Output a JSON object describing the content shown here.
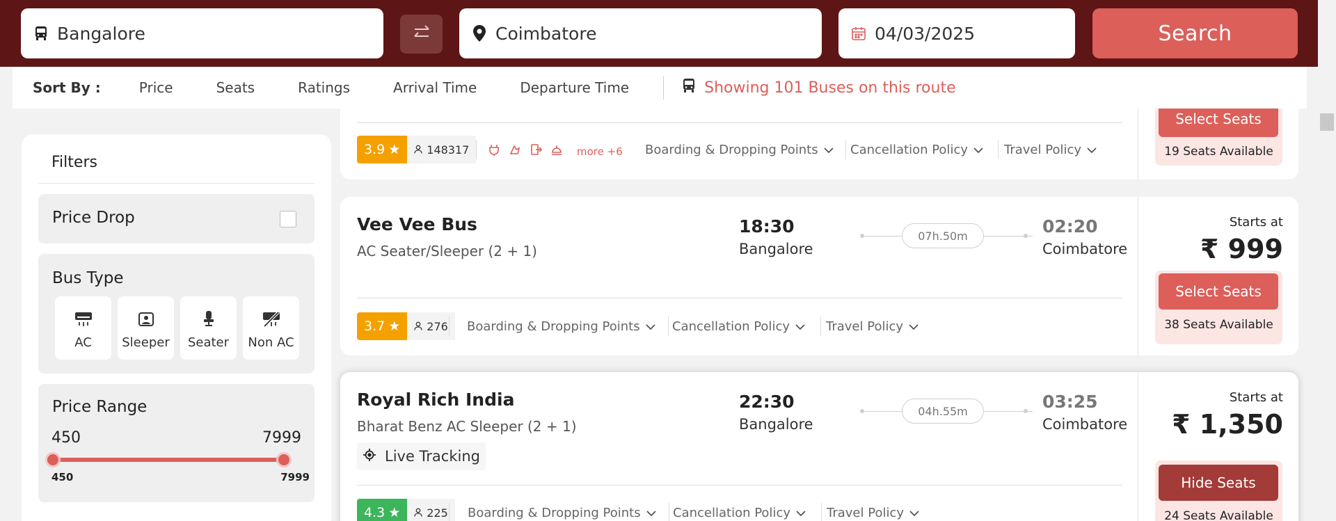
{
  "search": {
    "from": "Bangalore",
    "to": "Coimbatore",
    "date": "04/03/2025",
    "search_label": "Search"
  },
  "sort": {
    "label": "Sort By :",
    "options": [
      "Price",
      "Seats",
      "Ratings",
      "Arrival Time",
      "Departure Time"
    ],
    "showing": "Showing 101 Buses on this route"
  },
  "filters": {
    "title": "Filters",
    "price_drop": {
      "label": "Price Drop",
      "checked": false
    },
    "bus_type": {
      "title": "Bus Type",
      "options": [
        {
          "label": "AC",
          "icon": "ac-icon"
        },
        {
          "label": "Sleeper",
          "icon": "sleeper-icon"
        },
        {
          "label": "Seater",
          "icon": "seater-icon"
        },
        {
          "label": "Non AC",
          "icon": "non-ac-icon"
        }
      ]
    },
    "price_range": {
      "title": "Price Range",
      "min": "450",
      "max": "7999",
      "min_small": "450",
      "max_small": "7999"
    }
  },
  "buses": [
    {
      "rating": "3.9",
      "rating_count": "148317",
      "rating_color": "#f4a100",
      "amenities": [
        "charging-icon",
        "blanket-icon",
        "emergency-exit-icon",
        "reading-light-icon"
      ],
      "more_amenities": "more +6",
      "policies": [
        "Boarding & Dropping Points",
        "Cancellation Policy",
        "Travel Policy"
      ],
      "button": "Select Seats",
      "seats_available": "19 Seats Available"
    },
    {
      "name": "Vee Vee Bus",
      "type": "AC Seater/Sleeper (2 + 1)",
      "departure_time": "18:30",
      "departure_city": "Bangalore",
      "duration": "07h.50m",
      "arrival_time": "02:20",
      "arrival_city": "Coimbatore",
      "starts_at": "Starts at",
      "price": "₹ 999",
      "rating": "3.7",
      "rating_count": "276",
      "rating_color": "#f4a100",
      "policies": [
        "Boarding & Dropping Points",
        "Cancellation Policy",
        "Travel Policy"
      ],
      "button": "Select Seats",
      "seats_available": "38 Seats Available"
    },
    {
      "name": "Royal Rich India",
      "type": "Bharat Benz AC Sleeper (2 + 1)",
      "departure_time": "22:30",
      "departure_city": "Bangalore",
      "duration": "04h.55m",
      "arrival_time": "03:25",
      "arrival_city": "Coimbatore",
      "live_tracking": "Live Tracking",
      "starts_at": "Starts at",
      "price": "₹ 1,350",
      "rating": "4.3",
      "rating_count": "225",
      "rating_color": "#3cb55b",
      "policies": [
        "Boarding & Dropping Points",
        "Cancellation Policy",
        "Travel Policy"
      ],
      "button": "Hide Seats",
      "seats_available": "24 Seats Available"
    }
  ],
  "colors": {
    "brand_dark": "#5e1515",
    "accent": "#dc5f5a",
    "accent_dark": "#a33b38"
  }
}
